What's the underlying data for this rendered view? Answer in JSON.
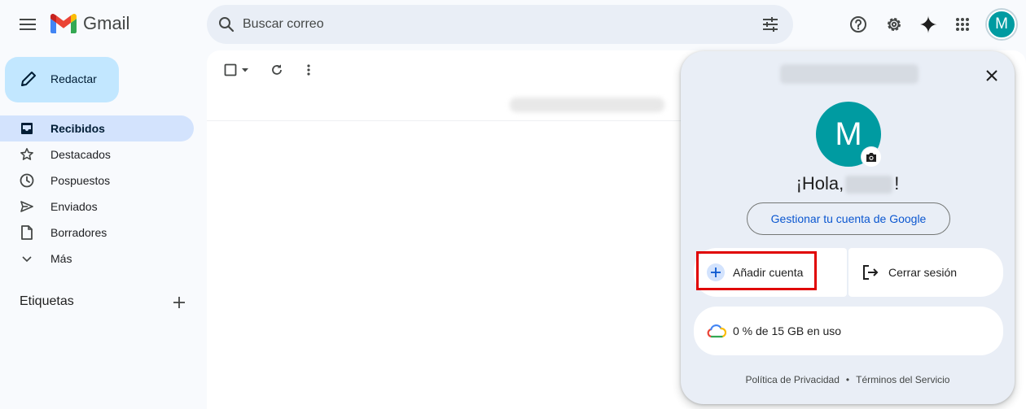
{
  "header": {
    "app_name": "Gmail",
    "search_placeholder": "Buscar correo",
    "avatar_letter": "M"
  },
  "sidebar": {
    "compose_label": "Redactar",
    "items": [
      {
        "label": "Recibidos",
        "icon": "inbox-icon",
        "active": true
      },
      {
        "label": "Destacados",
        "icon": "star-icon"
      },
      {
        "label": "Pospuestos",
        "icon": "clock-icon"
      },
      {
        "label": "Enviados",
        "icon": "send-icon"
      },
      {
        "label": "Borradores",
        "icon": "draft-icon"
      },
      {
        "label": "Más",
        "icon": "chevron-down-icon"
      }
    ],
    "labels_heading": "Etiquetas"
  },
  "account_panel": {
    "avatar_letter": "M",
    "greeting_prefix": "¡Hola,",
    "greeting_suffix": "!",
    "manage_label": "Gestionar tu cuenta de Google",
    "add_account_label": "Añadir cuenta",
    "sign_out_label": "Cerrar sesión",
    "storage_label": "0 % de 15 GB en uso",
    "privacy_label": "Política de Privacidad",
    "terms_label": "Términos del Servicio",
    "separator": "•"
  },
  "colors": {
    "accent": "#0b57d0",
    "avatar": "#009ba1",
    "compose": "#c2e7ff",
    "active_nav": "#d3e3fd",
    "highlight": "#e00000"
  }
}
